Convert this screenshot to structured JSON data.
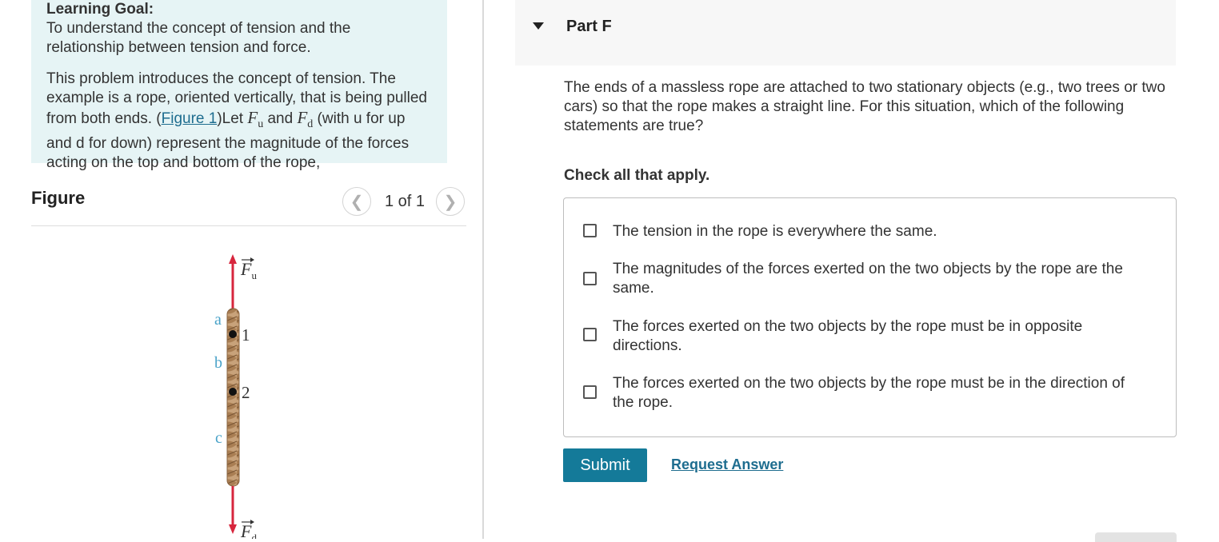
{
  "learning_goal": {
    "heading": "Learning Goal:",
    "text": "To understand the concept of tension and the relationship between tension and force.",
    "problem": {
      "text_1": "This problem introduces the concept of tension. The example is a rope, oriented vertically, that is being pulled from both ends. (",
      "figure_link": "Figure 1",
      "text_2": ")Let ",
      "symbol_fu": "F",
      "sub_u": "u",
      "text_3": " and ",
      "symbol_fd": "F",
      "sub_d": "d",
      "text_4": " (with u for up and d for down) represent the magnitude of the forces acting on the top and bottom of the rope,"
    }
  },
  "figure": {
    "title": "Figure",
    "counter": "1 of 1",
    "labels": {
      "force_up": "F",
      "force_up_sub": "u",
      "force_down": "F",
      "force_down_sub": "d",
      "a": "a",
      "b": "b",
      "c": "c",
      "point_1": "1",
      "point_2": "2"
    },
    "colors": {
      "arrow": "#d7263d",
      "rope": "#c8a27a",
      "letters": "#4aa3c9"
    }
  },
  "part": {
    "title": "Part F",
    "question": "The ends of a massless rope are attached to two stationary objects (e.g., two trees or two cars) so that the rope makes a straight line. For this situation, which of the following statements are true?",
    "instruction": "Check all that apply.",
    "options": [
      {
        "label": "The tension in the rope is everywhere the same.",
        "checked": false
      },
      {
        "label": "The magnitudes of the forces exerted on the two objects by the rope are the same.",
        "checked": false
      },
      {
        "label": "The forces exerted on the two objects by the rope must be in opposite directions.",
        "checked": false
      },
      {
        "label": "The forces exerted on the two objects by the rope must be in the direction of the rope.",
        "checked": false
      }
    ],
    "submit_label": "Submit",
    "request_answer_label": "Request Answer"
  }
}
